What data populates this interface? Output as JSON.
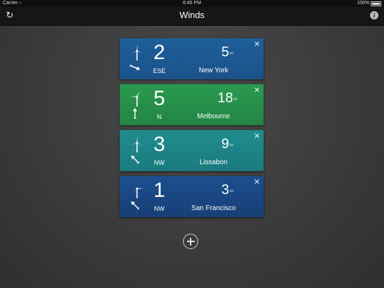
{
  "status": {
    "carrier": "Carrier",
    "time": "6:45 PM",
    "battery": "100%"
  },
  "nav": {
    "title": "Winds"
  },
  "cards": [
    {
      "force": "2",
      "direction": "ESE",
      "speed": "5",
      "unit": "kn",
      "city": "New York",
      "color_top": "#1f5f9a",
      "color_bottom": "#1a5289",
      "arrow_deg": 112
    },
    {
      "force": "5",
      "direction": "N",
      "speed": "18",
      "unit": "kn",
      "city": "Melbourne",
      "color_top": "#2a9a4f",
      "color_bottom": "#238445",
      "arrow_deg": 0
    },
    {
      "force": "3",
      "direction": "NW",
      "speed": "9",
      "unit": "kn",
      "city": "Lissabon",
      "color_top": "#1f8c8e",
      "color_bottom": "#1a7b7e",
      "arrow_deg": 315
    },
    {
      "force": "1",
      "direction": "NW",
      "speed": "3",
      "unit": "kn",
      "city": "San Francisco",
      "color_top": "#1c4f8f",
      "color_bottom": "#173f76",
      "arrow_deg": 315
    }
  ]
}
